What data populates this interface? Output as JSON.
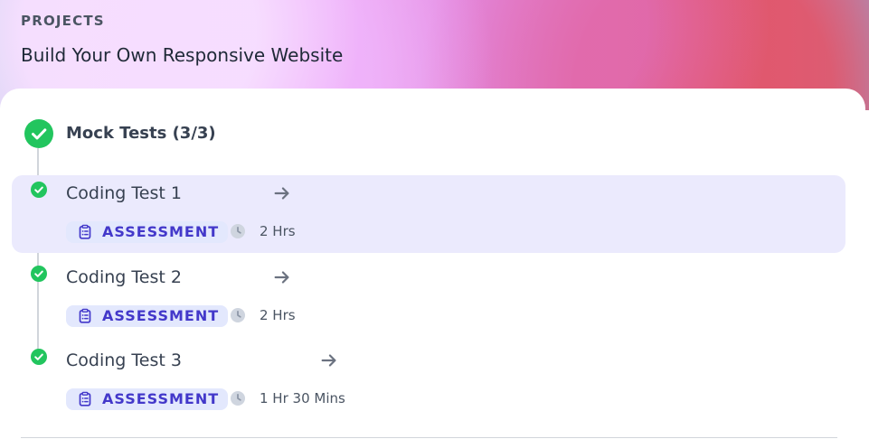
{
  "header": {
    "label": "PROJECTS",
    "title": "Build Your Own Responsive Website"
  },
  "section": {
    "title": "Mock Tests (3/3)"
  },
  "items": [
    {
      "title": "Coding Test 1",
      "badge": "ASSESSMENT",
      "duration": "2 Hrs",
      "active": true
    },
    {
      "title": "Coding Test 2",
      "badge": "ASSESSMENT",
      "duration": "2 Hrs",
      "active": false
    },
    {
      "title": "Coding Test 3",
      "badge": "ASSESSMENT",
      "duration": "1 Hr 30 Mins",
      "active": false
    }
  ],
  "colors": {
    "success": "#22c55e",
    "highlight": "#ebeafd",
    "badge_bg": "#e3e8fd",
    "badge_text": "#4338ca",
    "arrow": "#6b7280",
    "timeline": "#d1d5db"
  },
  "icons": {
    "section_status": "check-circle-icon",
    "item_status": "check-circle-icon",
    "open": "arrow-right-icon",
    "assessment": "clipboard-icon",
    "duration": "clock-icon"
  }
}
